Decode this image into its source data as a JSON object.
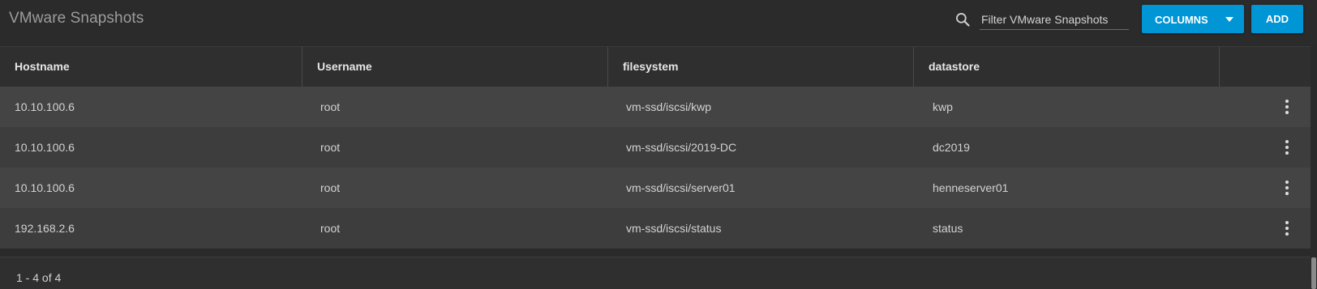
{
  "header": {
    "title": "VMware Snapshots",
    "filter_placeholder": "Filter VMware Snapshots",
    "columns_label": "COLUMNS",
    "add_label": "ADD"
  },
  "table": {
    "columns": [
      "Hostname",
      "Username",
      "filesystem",
      "datastore"
    ],
    "rows": [
      {
        "hostname": "10.10.100.6",
        "username": "root",
        "filesystem": "vm-ssd/iscsi/kwp",
        "datastore": "kwp"
      },
      {
        "hostname": "10.10.100.6",
        "username": "root",
        "filesystem": "vm-ssd/iscsi/2019-DC",
        "datastore": "dc2019"
      },
      {
        "hostname": "10.10.100.6",
        "username": "root",
        "filesystem": "vm-ssd/iscsi/server01",
        "datastore": "henneserver01"
      },
      {
        "hostname": "192.168.2.6",
        "username": "root",
        "filesystem": "vm-ssd/iscsi/status",
        "datastore": "status"
      }
    ]
  },
  "footer": {
    "range": "1 - 4 of 4"
  },
  "colors": {
    "accent": "#0095d5",
    "background": "#2a2a2a",
    "row_odd": "#444444",
    "row_even": "#3d3d3d"
  },
  "icons": {
    "search": "search-icon",
    "dropdown": "caret-down-icon",
    "row_menu": "more-vert-icon"
  }
}
